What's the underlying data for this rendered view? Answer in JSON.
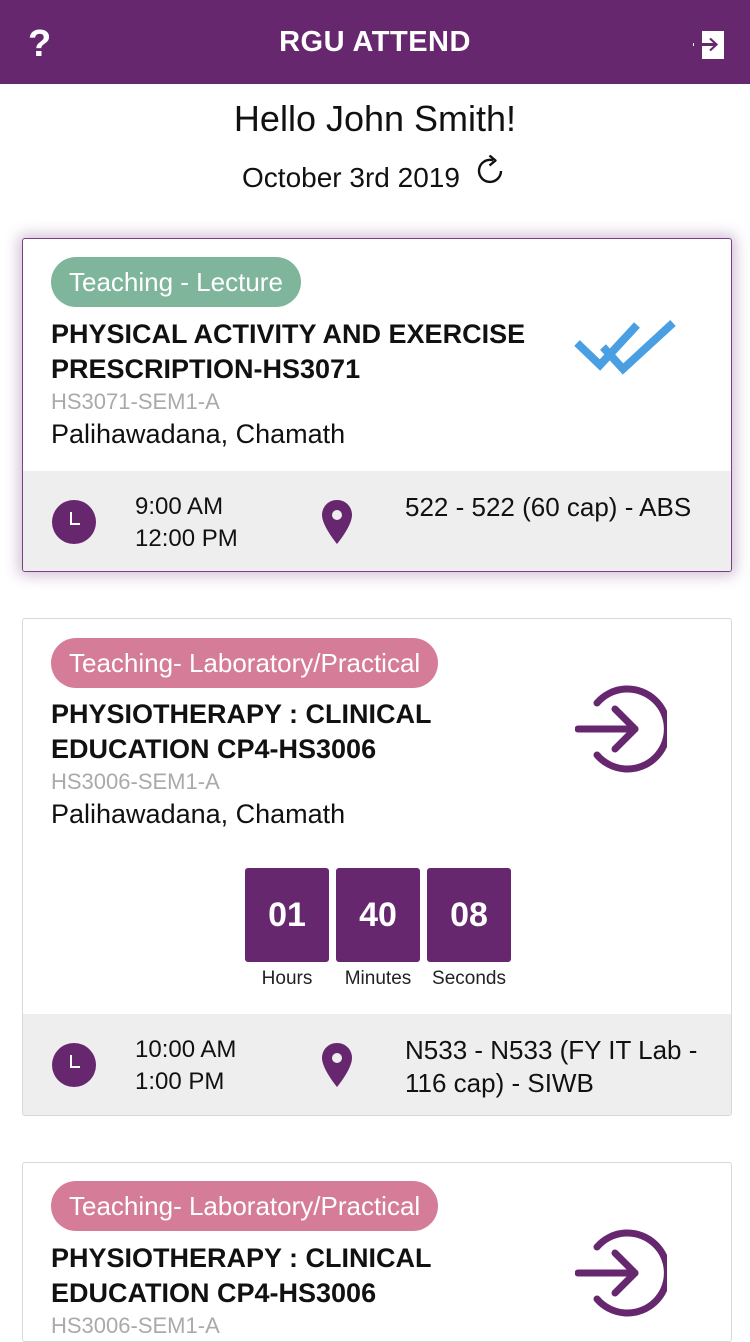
{
  "header": {
    "help_label": "?",
    "title": "RGU ATTEND",
    "logout_icon": "logout-icon"
  },
  "greeting": "Hello John Smith!",
  "date": "October 3rd 2019",
  "colors": {
    "brand": "#66276f",
    "tag_lecture": "#7fb59b",
    "tag_lab": "#d57c99",
    "check": "#4a9fe3",
    "info_bar": "#eeeeee"
  },
  "sessions": [
    {
      "tag": "Teaching - Lecture",
      "title": "PHYSICAL ACTIVITY AND EXERCISE PRESCRIPTION-HS3071",
      "code": "HS3071-SEM1-A",
      "lecturer": "Palihawadana, Chamath",
      "start": "9:00 AM",
      "end": "12:00 PM",
      "location": "522 - 522 (60 cap) - ABS",
      "status_icon": "double-check-icon"
    },
    {
      "tag": "Teaching- Laboratory/Practical",
      "title": "PHYSIOTHERAPY : CLINICAL EDUCATION CP4-HS3006",
      "code": "HS3006-SEM1-A",
      "lecturer": "Palihawadana, Chamath",
      "countdown": {
        "hours": "01",
        "minutes": "40",
        "seconds": "08",
        "hours_label": "Hours",
        "minutes_label": "Minutes",
        "seconds_label": "Seconds"
      },
      "start": "10:00 AM",
      "end": "1:00 PM",
      "location": "N533 - N533 (FY IT Lab - 116 cap) - SIWB",
      "status_icon": "check-in-icon"
    },
    {
      "tag": "Teaching- Laboratory/Practical",
      "title": "PHYSIOTHERAPY : CLINICAL EDUCATION CP4-HS3006",
      "code": "HS3006-SEM1-A",
      "status_icon": "check-in-icon"
    }
  ]
}
